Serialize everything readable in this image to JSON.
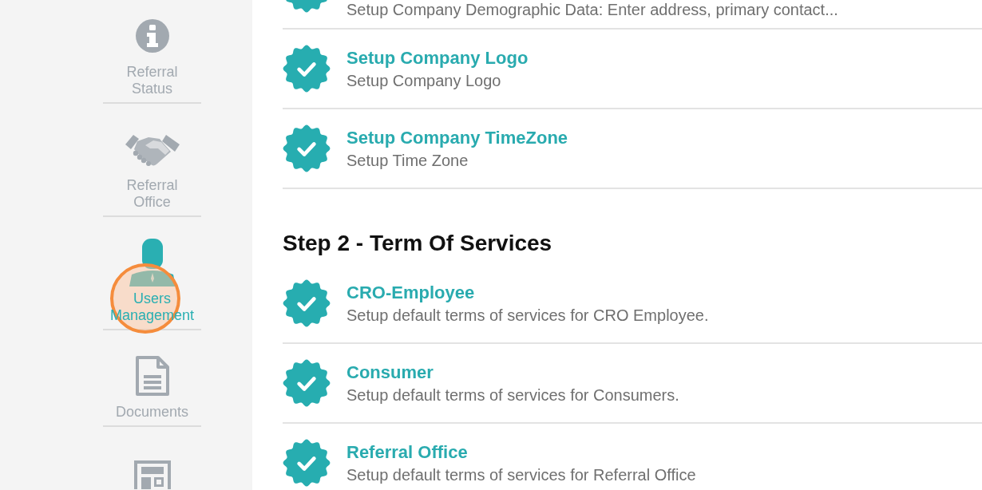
{
  "sidebar": {
    "items": [
      {
        "label": "Referral Status",
        "selected": false,
        "highlighted": false
      },
      {
        "label": "Referral Office",
        "selected": false,
        "highlighted": false
      },
      {
        "label": "Users Management",
        "selected": true,
        "highlighted": true
      },
      {
        "label": "Documents",
        "selected": false,
        "highlighted": false
      },
      {
        "selected": false,
        "highlighted": false
      }
    ]
  },
  "sections": [
    {
      "tasks": [
        {
          "description": "Setup Company Demographic Data: Enter address, primary contact...",
          "completed": true
        },
        {
          "title": "Setup Company Logo",
          "description": "Setup Company Logo",
          "completed": true
        },
        {
          "title": "Setup Company TimeZone",
          "description": "Setup Time Zone",
          "completed": true
        }
      ]
    },
    {
      "heading": "Step 2 - Term Of Services",
      "tasks": [
        {
          "title": "CRO-Employee",
          "description": "Setup default terms of services for CRO Employee.",
          "completed": true
        },
        {
          "title": "Consumer",
          "description": "Setup default terms of services for Consumers.",
          "completed": true
        },
        {
          "title": "Referral Office",
          "description": "Setup default terms of services for Referral Office",
          "completed": true
        }
      ]
    }
  ]
}
